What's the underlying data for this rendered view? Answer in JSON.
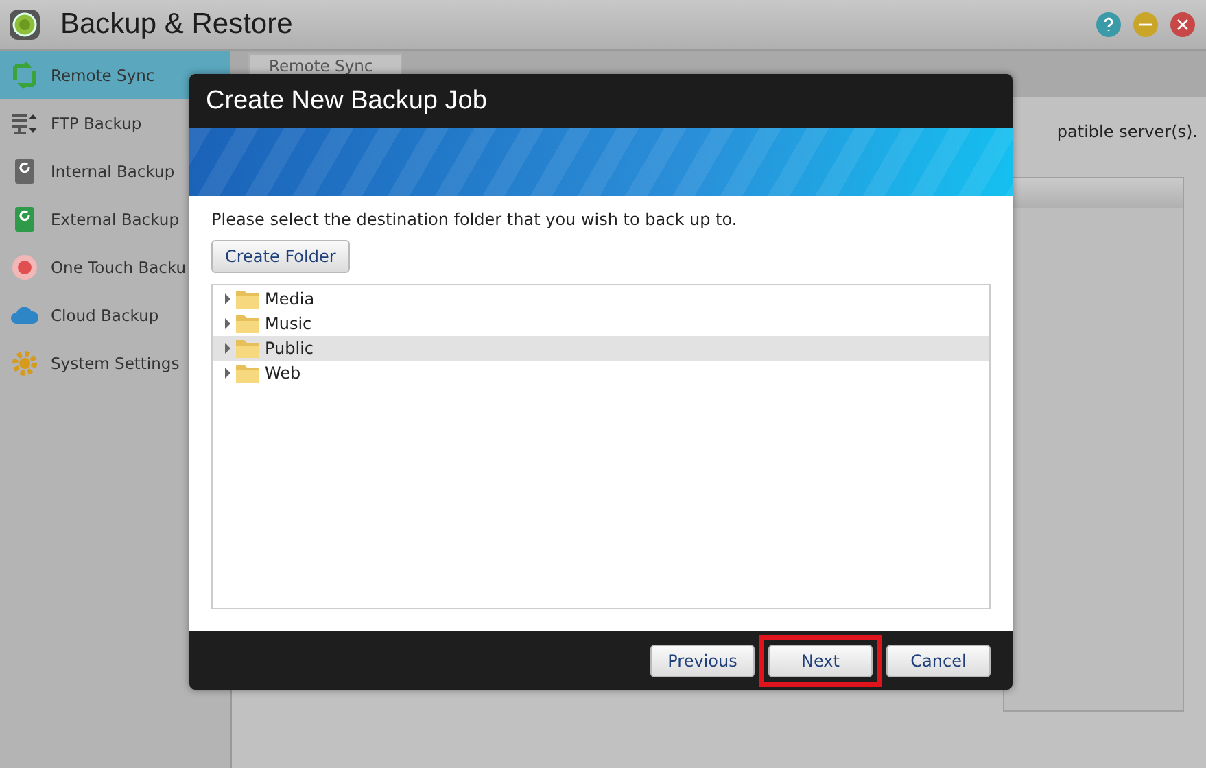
{
  "window": {
    "title": "Backup & Restore"
  },
  "sidebar": {
    "items": [
      {
        "label": "Remote Sync",
        "kind": "sync",
        "selected": true
      },
      {
        "label": "FTP Backup",
        "kind": "ftp",
        "selected": false
      },
      {
        "label": "Internal Backup",
        "kind": "internal",
        "selected": false
      },
      {
        "label": "External Backup",
        "kind": "external",
        "selected": false
      },
      {
        "label": "One Touch Backu",
        "kind": "onetouch",
        "selected": false
      },
      {
        "label": "Cloud Backup",
        "kind": "cloud",
        "selected": false
      },
      {
        "label": "System Settings",
        "kind": "settings",
        "selected": false
      }
    ]
  },
  "main": {
    "tab": "Remote Sync",
    "description": "patible server(s)."
  },
  "dialog": {
    "title": "Create New Backup Job",
    "instruction": "Please select the destination folder that you wish to back up to.",
    "create_folder_button": "Create Folder",
    "tree": [
      {
        "label": "Media",
        "selected": false
      },
      {
        "label": "Music",
        "selected": false
      },
      {
        "label": "Public",
        "selected": true
      },
      {
        "label": "Web",
        "selected": false
      }
    ],
    "buttons": [
      {
        "label": "Previous",
        "highlighted": false
      },
      {
        "label": "Next",
        "highlighted": true
      },
      {
        "label": "Cancel",
        "highlighted": false
      }
    ]
  }
}
